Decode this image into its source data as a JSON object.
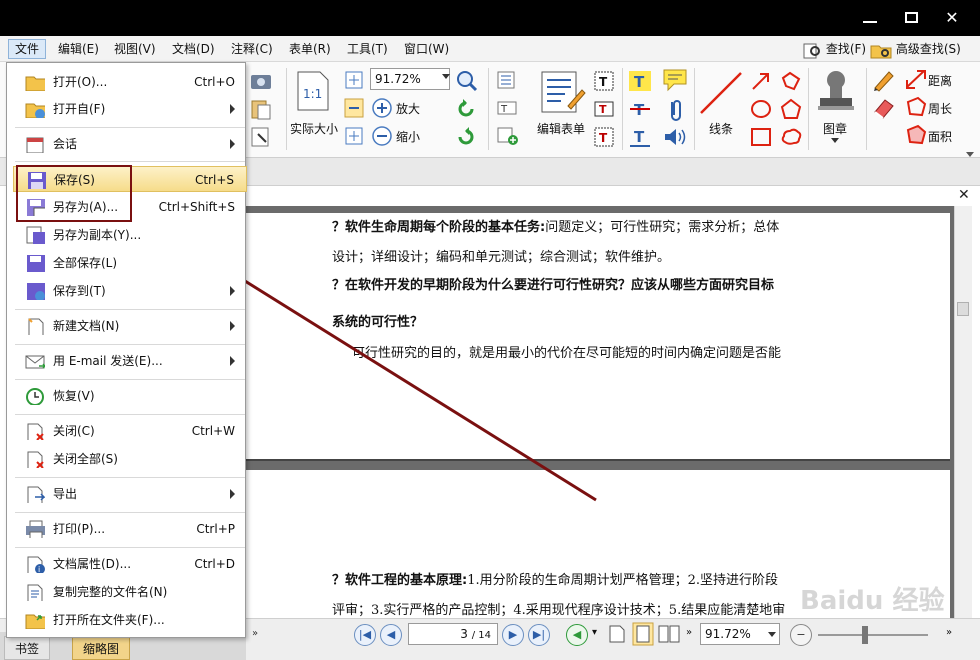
{
  "menubar": {
    "items": [
      "文件",
      "编辑(E)",
      "视图(V)",
      "文档(D)",
      "注释(C)",
      "表单(R)",
      "工具(T)",
      "窗口(W)"
    ],
    "find": "查找(F)",
    "advanced_find": "高级查找(S)"
  },
  "ribbon": {
    "zoom": "91.72%",
    "actual_size": "实际大小",
    "zoom_in": "放大",
    "zoom_out": "缩小",
    "edit_form": "编辑表单",
    "line": "线条",
    "stamp": "图章",
    "distance": "距离",
    "perimeter": "周长",
    "area": "面积"
  },
  "file_menu": {
    "items": [
      {
        "label": "打开(O)...",
        "shortcut": "Ctrl+O",
        "icon": "folder-open-icon"
      },
      {
        "label": "打开自(F)",
        "shortcut": "",
        "icon": "folder-globe-icon",
        "submenu": true
      },
      {
        "label": "会话",
        "shortcut": "",
        "icon": "calendar-icon",
        "submenu": true
      },
      {
        "label": "保存(S)",
        "shortcut": "Ctrl+S",
        "icon": "floppy-icon"
      },
      {
        "label": "另存为(A)...",
        "shortcut": "Ctrl+Shift+S",
        "icon": "save-as-icon"
      },
      {
        "label": "另存为副本(Y)...",
        "shortcut": "",
        "icon": "save-copy-icon"
      },
      {
        "label": "全部保存(L)",
        "shortcut": "",
        "icon": "save-all-icon"
      },
      {
        "label": "保存到(T)",
        "shortcut": "",
        "icon": "save-to-icon",
        "submenu": true
      },
      {
        "label": "新建文档(N)",
        "shortcut": "",
        "icon": "new-document-icon",
        "submenu": true
      },
      {
        "label": "用 E-mail 发送(E)...",
        "shortcut": "",
        "icon": "email-icon",
        "submenu": true
      },
      {
        "label": "恢复(V)",
        "shortcut": "",
        "icon": "restore-icon"
      },
      {
        "label": "关闭(C)",
        "shortcut": "Ctrl+W",
        "icon": "close-doc-icon"
      },
      {
        "label": "关闭全部(S)",
        "shortcut": "",
        "icon": "close-all-icon"
      },
      {
        "label": "导出",
        "shortcut": "",
        "icon": "export-icon",
        "submenu": true
      },
      {
        "label": "打印(P)...",
        "shortcut": "Ctrl+P",
        "icon": "printer-icon"
      },
      {
        "label": "文档属性(D)...",
        "shortcut": "Ctrl+D",
        "icon": "properties-icon"
      },
      {
        "label": "复制完整的文件名(N)",
        "shortcut": "",
        "icon": "copy-filename-icon"
      },
      {
        "label": "打开所在文件夹(F)...",
        "shortcut": "",
        "icon": "folder-icon"
      }
    ]
  },
  "document": {
    "line1_bold": "？软件生命周期每个阶段的基本任务:",
    "line1_rest": "问题定义；可行性研究；需求分析；总体",
    "line2": "设计；详细设计；编码和单元测试；综合测试；软件维护。",
    "line3": "？在软件开发的早期阶段为什么要进行可行性研究？应该从哪些方面研究目标",
    "line4": "系统的可行性？",
    "line5": "可行性研究的目的，就是用最小的代价在尽可能短的时间内确定问题是否能",
    "line6_bold": "？软件工程的基本原理:",
    "line6_rest": "1.用分阶段的生命周期计划严格管理；2.坚持进行阶段",
    "line7": "评审；3.实行严格的产品控制；4.采用现代程序设计技术；5.结果应能清楚地审"
  },
  "statusbar": {
    "page": "3",
    "total": "/ 14",
    "zoom": "91.72%",
    "tab1": "书签",
    "tab2": "缩略图"
  },
  "watermark": "Baidu 经验"
}
